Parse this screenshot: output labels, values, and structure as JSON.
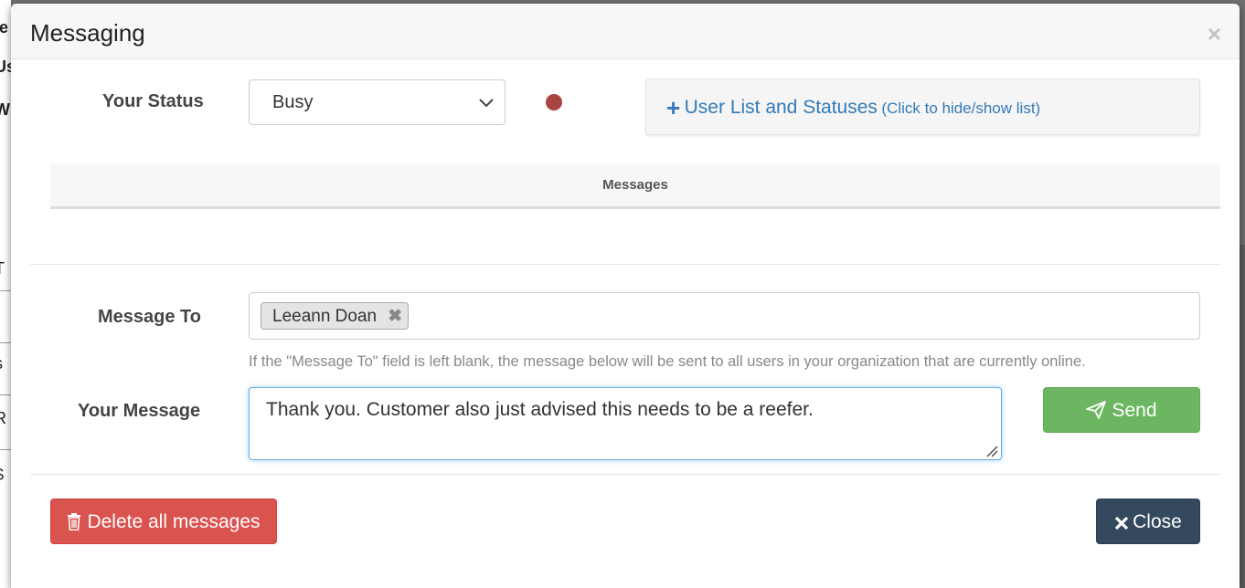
{
  "background": {
    "fragments": [
      "le",
      "Us",
      "Wi",
      "T",
      "s",
      "R",
      "$"
    ]
  },
  "modal": {
    "title": "Messaging",
    "close_glyph": "×"
  },
  "status": {
    "label": "Your Status",
    "selected": "Busy",
    "indicator_color": "#a94442"
  },
  "user_list": {
    "plus": "+",
    "label": "User List and Statuses",
    "hint": "(Click to hide/show list)"
  },
  "messages": {
    "header": "Messages"
  },
  "message_to": {
    "label": "Message To",
    "recipients": [
      {
        "name": "Leeann Doan",
        "remove_glyph": "✖"
      }
    ],
    "help": "If the \"Message To\" field is left blank, the message below will be sent to all users in your organization that are currently online."
  },
  "your_message": {
    "label": "Your Message",
    "value": "Thank you. Customer also just advised this needs to be a reefer."
  },
  "buttons": {
    "send": "Send",
    "delete_all": "Delete all messages",
    "close": "Close"
  },
  "colors": {
    "send": "#6cb661",
    "delete": "#d9534f",
    "close": "#34495e",
    "link": "#337ab7"
  },
  "icons": {
    "close_x": "close-icon",
    "select_arrow": "chevron-down-icon",
    "send": "paper-plane-icon",
    "delete": "trash-icon",
    "close_button": "times-icon"
  }
}
